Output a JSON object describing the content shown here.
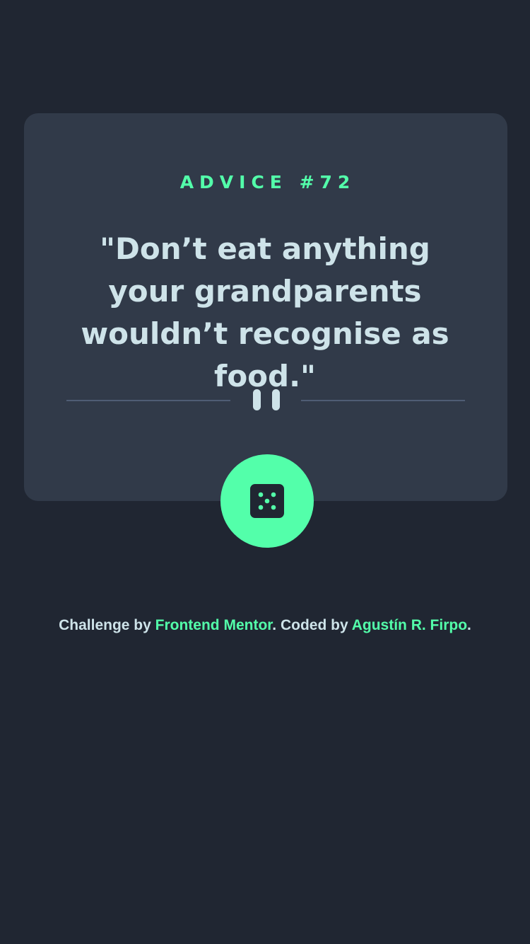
{
  "advice": {
    "label": "ADVICE #72",
    "quote": "\"Don’t eat anything your grandparents wouldn’t recognise as food.\""
  },
  "divider": {
    "icon": "pause-icon"
  },
  "dice_button": {
    "icon": "dice-icon"
  },
  "footer": {
    "prefix": "Challenge by ",
    "link1": "Frontend Mentor",
    "middle": ". Coded by ",
    "link2": "Agustín R. Firpo",
    "suffix": "."
  },
  "colors": {
    "background": "#202632",
    "card": "#313a49",
    "accent": "#53ffaa",
    "text": "#cee3e9",
    "divider": "#4f5d74"
  }
}
